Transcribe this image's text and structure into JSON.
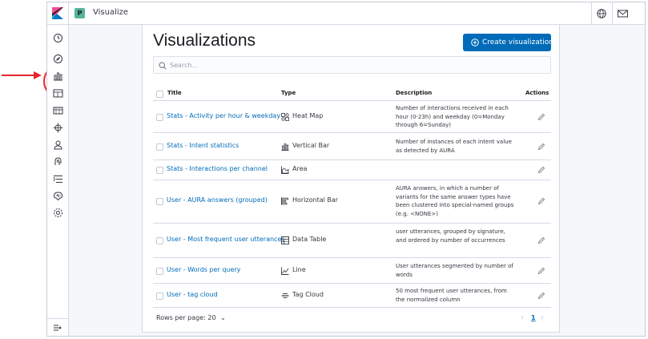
{
  "app": {
    "breadcrumb": "Visualize",
    "space_initial": "P"
  },
  "page": {
    "title": "Visualizations",
    "create_label": "Create visualization",
    "search_placeholder": "Search..."
  },
  "table": {
    "headers": {
      "title": "Title",
      "type": "Type",
      "description": "Description",
      "actions": "Actions"
    },
    "rows": [
      {
        "title": "Stats - Activity per hour & weekday",
        "type": "Heat Map",
        "type_icon": "heatmap-icon",
        "description": "Number of interactions received in each hour (0-23h) and weekday (0=Monday through 6=Sunday)"
      },
      {
        "title": "Stats - Intent statistics",
        "type": "Vertical Bar",
        "type_icon": "vertical-bar-icon",
        "description": "Number of instances of each intent value as detected by AURA"
      },
      {
        "title": "Stats - Interactions per channel",
        "type": "Area",
        "type_icon": "area-chart-icon",
        "description": ""
      },
      {
        "title": "User - AURA answers (grouped)",
        "type": "Horizontal Bar",
        "type_icon": "horizontal-bar-icon",
        "description": "AURA answers, in which a number of variants for the same answer types have been clustered into special-named groups (e.g. <NONE>)"
      },
      {
        "title": "User - Most frequent user utterances",
        "type": "Data Table",
        "type_icon": "data-table-icon",
        "description": "user utterances, grouped by signature, and ordered by number of occurrences"
      },
      {
        "title": "User - Words per query",
        "type": "Line",
        "type_icon": "line-chart-icon",
        "description": "User utterances segmented by number of words"
      },
      {
        "title": "User - tag cloud",
        "type": "Tag Cloud",
        "type_icon": "tag-cloud-icon",
        "description": "50 most frequent user utterances, from the normalized column"
      }
    ]
  },
  "footer": {
    "rows_per_page": "Rows per page: 20",
    "current_page": "1"
  },
  "colors": {
    "accent": "#006bb8",
    "annotation": "#e8252e"
  }
}
